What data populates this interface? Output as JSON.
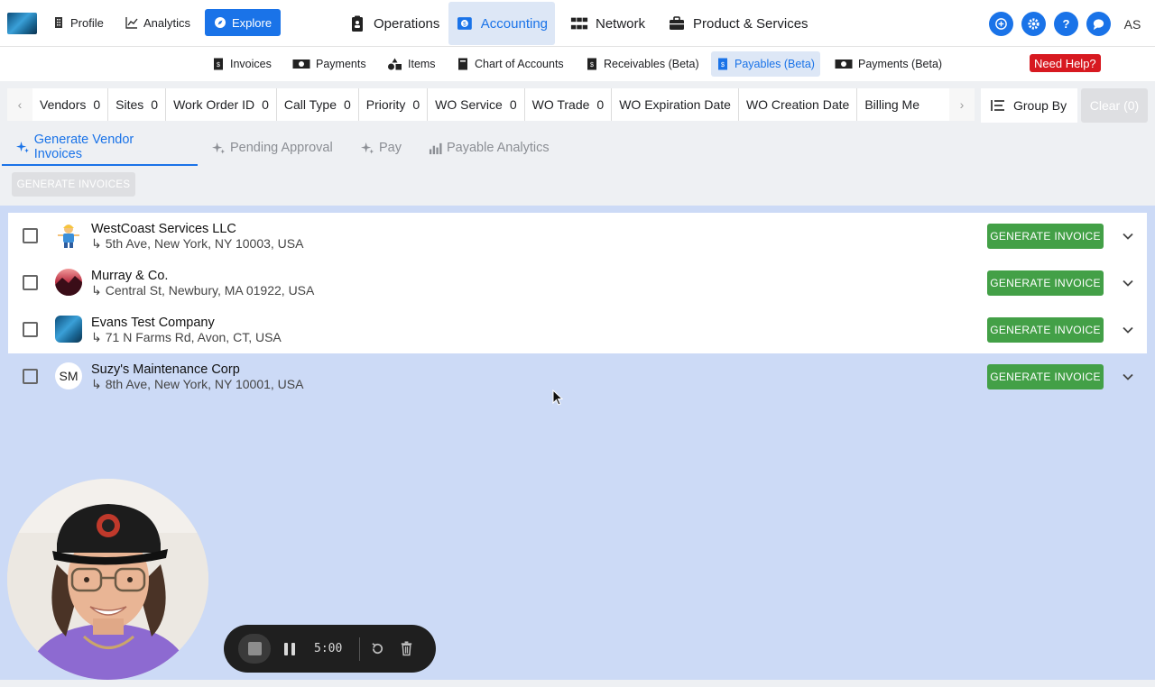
{
  "topnav": {
    "left_items": [
      {
        "label": "Profile",
        "icon": "building-icon"
      },
      {
        "label": "Analytics",
        "icon": "chart-line-icon"
      },
      {
        "label": "Explore",
        "icon": "compass-icon"
      }
    ],
    "mid_items": [
      {
        "label": "Operations",
        "icon": "clipboard-icon"
      },
      {
        "label": "Accounting",
        "icon": "accounting-icon"
      },
      {
        "label": "Network",
        "icon": "network-icon"
      },
      {
        "label": "Product & Services",
        "icon": "briefcase-icon"
      }
    ],
    "user_initials": "AS"
  },
  "subnav": {
    "items": [
      {
        "label": "Invoices"
      },
      {
        "label": "Payments"
      },
      {
        "label": "Items"
      },
      {
        "label": "Chart of Accounts"
      },
      {
        "label": "Receivables (Beta)"
      },
      {
        "label": "Payables (Beta)"
      },
      {
        "label": "Payments (Beta)"
      }
    ],
    "help_label": "Need Help?"
  },
  "filters": {
    "chips": [
      {
        "label": "Vendors",
        "count": "0"
      },
      {
        "label": "Sites",
        "count": "0"
      },
      {
        "label": "Work Order ID",
        "count": "0"
      },
      {
        "label": "Call Type",
        "count": "0"
      },
      {
        "label": "Priority",
        "count": "0"
      },
      {
        "label": "WO Service",
        "count": "0"
      },
      {
        "label": "WO Trade",
        "count": "0"
      },
      {
        "label": "WO Expiration Date",
        "count": ""
      },
      {
        "label": "WO Creation Date",
        "count": ""
      },
      {
        "label": "Billing Me",
        "count": ""
      }
    ],
    "group_by_label": "Group By",
    "clear_label": "Clear (0)"
  },
  "tabs": [
    {
      "label": "Generate Vendor Invoices"
    },
    {
      "label": "Pending Approval"
    },
    {
      "label": "Pay"
    },
    {
      "label": "Payable Analytics"
    }
  ],
  "actions": {
    "generate_all_label": "GENERATE INVOICES"
  },
  "vendors": [
    {
      "name": "WestCoast Services LLC",
      "address": "5th Ave, New York, NY 10003, USA",
      "avatar": ""
    },
    {
      "name": "Murray & Co.",
      "address": "Central St, Newbury, MA 01922, USA",
      "avatar": ""
    },
    {
      "name": "Evans Test Company",
      "address": "71 N Farms Rd, Avon, CT, USA",
      "avatar": ""
    },
    {
      "name": "Suzy's Maintenance Corp",
      "address": "8th Ave, New York, NY 10001, USA",
      "avatar": "SM"
    }
  ],
  "row_action_label": "GENERATE INVOICE",
  "address_prefix": "↳",
  "recorder": {
    "time": "5:00"
  },
  "colors": {
    "primary": "#1a73e8",
    "success": "#43a047",
    "danger": "#d71920",
    "highlight": "#ccdaf6"
  }
}
